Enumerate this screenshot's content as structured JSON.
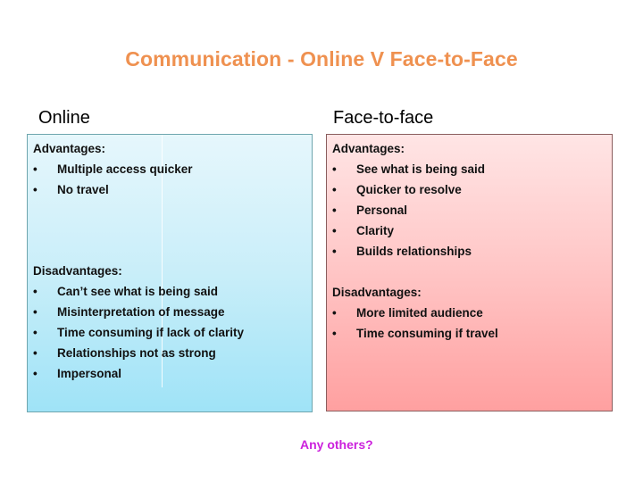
{
  "title": "Communication - Online V Face-to-Face",
  "columns": [
    {
      "heading": "Online",
      "advantages_label": "Advantages:",
      "advantages": [
        "Multiple access quicker",
        "No travel"
      ],
      "disadvantages_label": "Disadvantages:",
      "disadvantages": [
        "Can’t see what is being said",
        "Misinterpretation of message",
        "Time consuming if lack of clarity",
        "Relationships not as strong",
        "Impersonal"
      ],
      "color": "#9fe3f7"
    },
    {
      "heading": "Face-to-face",
      "advantages_label": "Advantages:",
      "advantages": [
        "See what is being said",
        "Quicker to resolve",
        "Personal",
        "Clarity",
        "Builds relationships"
      ],
      "disadvantages_label": "Disadvantages:",
      "disadvantages": [
        "More limited audience",
        "Time consuming if travel"
      ],
      "color": "#ffa0a0"
    }
  ],
  "bullet_glyph": "•",
  "footer_prompt": "Any others?",
  "colors": {
    "title": "#ef9150",
    "prompt": "#cc22dd"
  }
}
